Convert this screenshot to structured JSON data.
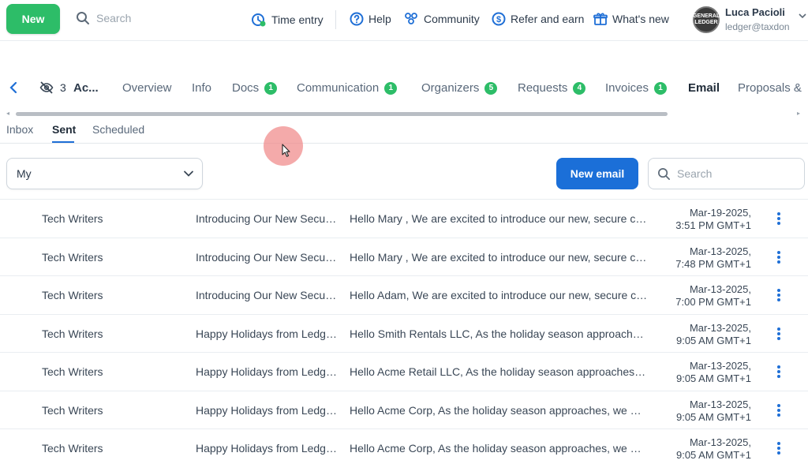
{
  "topbar": {
    "new_label": "New",
    "search_placeholder": "Search",
    "nav": [
      {
        "label": "Time entry",
        "icon": "clock-icon"
      },
      {
        "label": "Help",
        "icon": "help-icon"
      },
      {
        "label": "Community",
        "icon": "community-icon"
      },
      {
        "label": "Refer and earn",
        "icon": "dollar-icon"
      },
      {
        "label": "What's new",
        "icon": "gift-icon"
      }
    ],
    "user": {
      "name": "Luca Pacioli",
      "email": "ledger@taxdon",
      "avatar_text": "GENERAL LEDGER"
    }
  },
  "entity_tabs": {
    "hidden_count": "3",
    "account_label": "Ac...",
    "tabs": [
      {
        "label": "Overview",
        "badge": ""
      },
      {
        "label": "Info",
        "badge": ""
      },
      {
        "label": "Docs",
        "badge": "1"
      },
      {
        "label": "Communication",
        "badge": "1"
      },
      {
        "label": "Organizers",
        "badge": "5"
      },
      {
        "label": "Requests",
        "badge": "4"
      },
      {
        "label": "Invoices",
        "badge": "1"
      },
      {
        "label": "Email",
        "badge": ""
      },
      {
        "label": "Proposals &",
        "badge": ""
      }
    ],
    "active": "Email"
  },
  "sub_tabs": {
    "tabs": [
      "Inbox",
      "Sent",
      "Scheduled"
    ],
    "active": "Sent"
  },
  "filters": {
    "owner_value": "My",
    "new_email_label": "New email",
    "search_placeholder": "Search"
  },
  "emails": [
    {
      "from": "Tech Writers",
      "subject": "Introducing Our New Secure Client Portal",
      "preview": "Hello Mary , We are excited to introduce our new, secure client portal",
      "date": "Mar-19-2025,",
      "time": "3:51 PM GMT+1"
    },
    {
      "from": "Tech Writers",
      "subject": "Introducing Our New Secure Client Portal",
      "preview": "Hello Mary , We are excited to introduce our new, secure client portal",
      "date": "Mar-13-2025,",
      "time": "7:48 PM GMT+1"
    },
    {
      "from": "Tech Writers",
      "subject": "Introducing Our New Secure Client Portal",
      "preview": "Hello Adam, We are excited to introduce our new, secure client portal",
      "date": "Mar-13-2025,",
      "time": "7:00 PM GMT+1"
    },
    {
      "from": "Tech Writers",
      "subject": "Happy Holidays from Ledger!",
      "preview": "Hello Smith Rentals LLC, As the holiday season approaches, we want to",
      "date": "Mar-13-2025,",
      "time": "9:05 AM GMT+1"
    },
    {
      "from": "Tech Writers",
      "subject": "Happy Holidays from Ledger!",
      "preview": "Hello Acme Retail LLC, As the holiday season approaches, we want to",
      "date": "Mar-13-2025,",
      "time": "9:05 AM GMT+1"
    },
    {
      "from": "Tech Writers",
      "subject": "Happy Holidays from Ledger!",
      "preview": "Hello Acme Corp, As the holiday season approaches, we want to",
      "date": "Mar-13-2025,",
      "time": "9:05 AM GMT+1"
    },
    {
      "from": "Tech Writers",
      "subject": "Happy Holidays from Ledger!",
      "preview": "Hello Acme Corp, As the holiday season approaches, we want to",
      "date": "Mar-13-2025,",
      "time": "9:05 AM GMT+1"
    }
  ],
  "colors": {
    "brand_green": "#2dbd68",
    "primary_blue": "#1b6fd8",
    "icon_blue": "#1f6fd6"
  }
}
